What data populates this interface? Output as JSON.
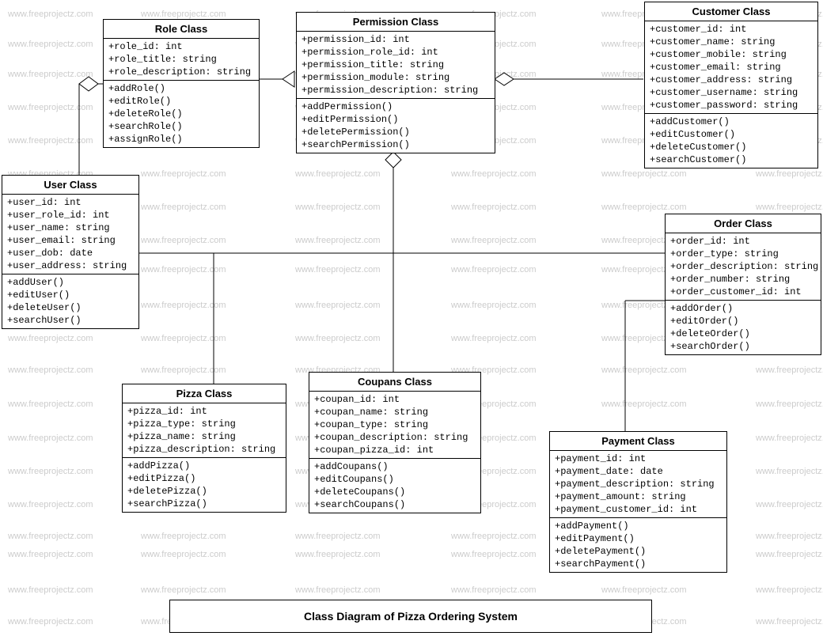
{
  "caption": "Class Diagram of Pizza Ordering System",
  "watermark_text": "www.freeprojectz.com",
  "classes": {
    "role": {
      "title": "Role Class",
      "attrs": [
        "+role_id: int",
        "+role_title: string",
        "+role_description: string"
      ],
      "ops": [
        "+addRole()",
        "+editRole()",
        "+deleteRole()",
        "+searchRole()",
        "+assignRole()"
      ]
    },
    "permission": {
      "title": "Permission Class",
      "attrs": [
        "+permission_id: int",
        "+permission_role_id: int",
        "+permission_title: string",
        "+permission_module: string",
        "+permission_description: string"
      ],
      "ops": [
        "+addPermission()",
        "+editPermission()",
        "+deletePermission()",
        "+searchPermission()"
      ]
    },
    "customer": {
      "title": "Customer Class",
      "attrs": [
        "+customer_id: int",
        "+customer_name: string",
        "+customer_mobile: string",
        "+customer_email: string",
        "+customer_address: string",
        "+customer_username: string",
        "+customer_password: string"
      ],
      "ops": [
        "+addCustomer()",
        "+editCustomer()",
        "+deleteCustomer()",
        "+searchCustomer()"
      ]
    },
    "user": {
      "title": "User Class",
      "attrs": [
        "+user_id: int",
        "+user_role_id: int",
        "+user_name: string",
        "+user_email: string",
        "+user_dob: date",
        "+user_address: string"
      ],
      "ops": [
        "+addUser()",
        "+editUser()",
        "+deleteUser()",
        "+searchUser()"
      ]
    },
    "order": {
      "title": "Order Class",
      "attrs": [
        "+order_id: int",
        "+order_type: string",
        "+order_description: string",
        "+order_number: string",
        "+order_customer_id: int"
      ],
      "ops": [
        "+addOrder()",
        "+editOrder()",
        "+deleteOrder()",
        "+searchOrder()"
      ]
    },
    "pizza": {
      "title": "Pizza Class",
      "attrs": [
        "+pizza_id: int",
        "+pizza_type: string",
        "+pizza_name: string",
        "+pizza_description: string"
      ],
      "ops": [
        "+addPizza()",
        "+editPizza()",
        "+deletePizza()",
        "+searchPizza()"
      ]
    },
    "coupans": {
      "title": "Coupans  Class",
      "attrs": [
        "+coupan_id: int",
        "+coupan_name: string",
        "+coupan_type: string",
        "+coupan_description: string",
        "+coupan_pizza_id: int"
      ],
      "ops": [
        "+addCoupans()",
        "+editCoupans()",
        "+deleteCoupans()",
        "+searchCoupans()"
      ]
    },
    "payment": {
      "title": "Payment Class",
      "attrs": [
        "+payment_id: int",
        "+payment_date: date",
        "+payment_description: string",
        "+payment_amount: string",
        "+payment_customer_id: int"
      ],
      "ops": [
        "+addPayment()",
        "+editPayment()",
        "+deletePayment()",
        "+searchPayment()"
      ]
    }
  }
}
